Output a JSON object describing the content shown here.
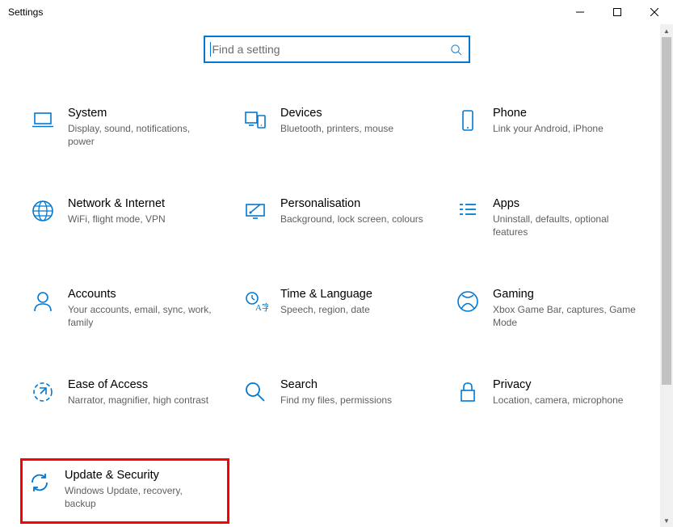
{
  "window": {
    "title": "Settings"
  },
  "search": {
    "placeholder": "Find a setting"
  },
  "tiles": {
    "system": {
      "title": "System",
      "desc": "Display, sound, notifications, power"
    },
    "devices": {
      "title": "Devices",
      "desc": "Bluetooth, printers, mouse"
    },
    "phone": {
      "title": "Phone",
      "desc": "Link your Android, iPhone"
    },
    "network": {
      "title": "Network & Internet",
      "desc": "WiFi, flight mode, VPN"
    },
    "personal": {
      "title": "Personalisation",
      "desc": "Background, lock screen, colours"
    },
    "apps": {
      "title": "Apps",
      "desc": "Uninstall, defaults, optional features"
    },
    "accounts": {
      "title": "Accounts",
      "desc": "Your accounts, email, sync, work, family"
    },
    "time": {
      "title": "Time & Language",
      "desc": "Speech, region, date"
    },
    "gaming": {
      "title": "Gaming",
      "desc": "Xbox Game Bar, captures, Game Mode"
    },
    "ease": {
      "title": "Ease of Access",
      "desc": "Narrator, magnifier, high contrast"
    },
    "searchcat": {
      "title": "Search",
      "desc": "Find my files, permissions"
    },
    "privacy": {
      "title": "Privacy",
      "desc": "Location, camera, microphone"
    },
    "update": {
      "title": "Update & Security",
      "desc": "Windows Update, recovery, backup"
    }
  },
  "highlight": "update",
  "colors": {
    "accent": "#0078d4",
    "highlight_border": "#ff0000"
  }
}
